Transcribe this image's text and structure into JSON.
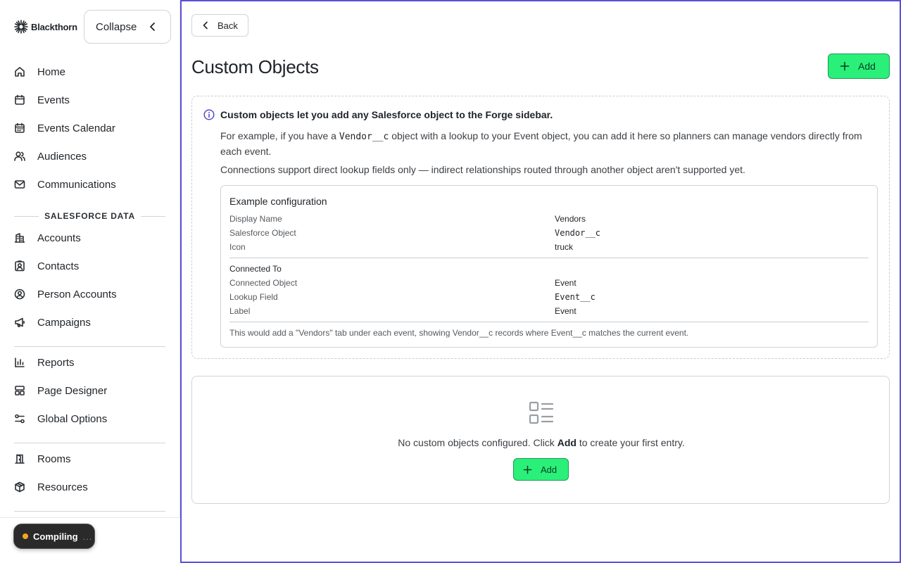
{
  "sidebar": {
    "brand": "Blackthorn",
    "collapse_label": "Collapse",
    "nav_primary": [
      {
        "label": "Home",
        "icon": "home-icon"
      },
      {
        "label": "Events",
        "icon": "calendar-icon"
      },
      {
        "label": "Events Calendar",
        "icon": "calendar-grid-icon"
      },
      {
        "label": "Audiences",
        "icon": "users-icon"
      },
      {
        "label": "Communications",
        "icon": "mail-icon"
      }
    ],
    "section_title": "SALESFORCE DATA",
    "nav_salesforce": [
      {
        "label": "Accounts",
        "icon": "building-icon"
      },
      {
        "label": "Contacts",
        "icon": "contact-icon"
      },
      {
        "label": "Person Accounts",
        "icon": "person-circle-icon"
      },
      {
        "label": "Campaigns",
        "icon": "megaphone-icon"
      }
    ],
    "nav_tools": [
      {
        "label": "Reports",
        "icon": "bar-chart-icon"
      },
      {
        "label": "Page Designer",
        "icon": "layout-icon"
      },
      {
        "label": "Global Options",
        "icon": "sliders-icon"
      }
    ],
    "nav_resources": [
      {
        "label": "Rooms",
        "icon": "door-icon"
      },
      {
        "label": "Resources",
        "icon": "package-icon"
      }
    ],
    "status": {
      "label": "Compiling",
      "ellipsis": "...",
      "color": "#f5a524"
    }
  },
  "main": {
    "back_label": "Back",
    "title": "Custom Objects",
    "add_label": "Add",
    "info": {
      "heading": "Custom objects let you add any Salesforce object to the Forge sidebar.",
      "p1_before": "For example, if you have a",
      "p1_code": "Vendor__c",
      "p1_after": "object with a lookup to your Event object, you can add it here so planners can manage vendors directly from each event.",
      "p2": "Connections support direct lookup fields only — indirect relationships routed through another object aren't supported yet."
    },
    "example": {
      "title": "Example configuration",
      "rows": [
        {
          "key": "Display Name",
          "value": "Vendors"
        },
        {
          "key": "Salesforce Object",
          "value": "Vendor__c"
        },
        {
          "key": "Icon",
          "value": "truck"
        }
      ],
      "connected_title": "Connected To",
      "connected_rows": [
        {
          "key": "Connected Object",
          "value": "Event"
        },
        {
          "key": "Lookup Field",
          "value": "Event__c"
        },
        {
          "key": "Label",
          "value": "Event"
        }
      ],
      "note": "This would add a \"Vendors\" tab under each event, showing Vendor__c records where Event__c matches the current event."
    },
    "empty": {
      "text_before": "No custom objects configured. Click",
      "text_bold": "Add",
      "text_after": "to create your first entry.",
      "add_label": "Add"
    }
  },
  "colors": {
    "accent_green": "#2af07a",
    "focus_border": "#5b4fd6",
    "status_dot": "#f5a524"
  }
}
